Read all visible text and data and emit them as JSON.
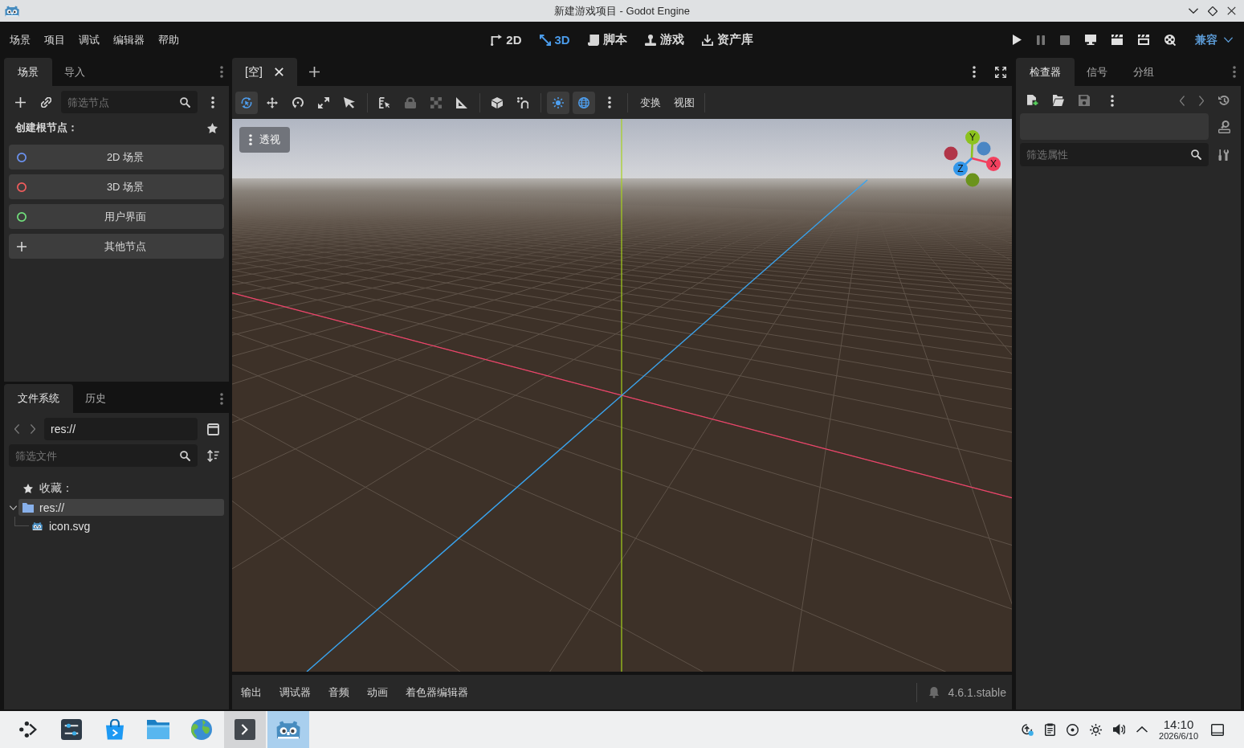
{
  "window": {
    "title": "新建游戏项目 - Godot Engine"
  },
  "menu_bar": {
    "menus": [
      "场景",
      "项目",
      "调试",
      "编辑器",
      "帮助"
    ],
    "main_screens": [
      {
        "label": "2D",
        "selected": false
      },
      {
        "label": "3D",
        "selected": true
      },
      {
        "label": "脚本",
        "selected": false
      },
      {
        "label": "游戏",
        "selected": false
      },
      {
        "label": "资产库",
        "selected": false
      }
    ],
    "run_buttons": [
      {
        "disabled": false
      },
      {
        "disabled": true
      },
      {
        "disabled": true
      },
      {
        "disabled": false
      },
      {
        "disabled": false
      },
      {
        "disabled": false
      },
      {
        "disabled": false
      }
    ],
    "renderer": "兼容"
  },
  "scene_dock": {
    "tabs": [
      {
        "label": "场景",
        "selected": true
      },
      {
        "label": "导入",
        "selected": false
      }
    ],
    "filter": {
      "placeholder": "筛选节点"
    },
    "heading": "创建根节点：",
    "root_options": [
      {
        "label": "2D 场景",
        "kind": "circle",
        "color": "#6c93f2"
      },
      {
        "label": "3D 场景",
        "kind": "circle",
        "color": "#f25d5d"
      },
      {
        "label": "用户界面",
        "kind": "circle",
        "color": "#71e07c"
      },
      {
        "label": "其他节点",
        "kind": "plus"
      }
    ]
  },
  "filesystem_dock": {
    "tabs": [
      {
        "label": "文件系统",
        "selected": true
      },
      {
        "label": "历史",
        "selected": false
      }
    ],
    "nav": [
      {
        "disabled": true
      },
      {
        "disabled": true
      }
    ],
    "path": "res://",
    "filter": {
      "placeholder": "筛选文件"
    },
    "favorites": "收藏：",
    "tree": [
      {
        "label": "res://",
        "kind": "folder",
        "selected": true,
        "expanded": true,
        "children": [
          {
            "label": "icon.svg",
            "kind": "file",
            "selected": false
          }
        ]
      }
    ]
  },
  "scene_tabs": [
    {
      "label": "[空]",
      "selected": true
    }
  ],
  "viewport_toolbar": {
    "tool_groups": [
      [
        {
          "selected": true,
          "disabled": false
        },
        {
          "selected": false,
          "disabled": false
        },
        {
          "selected": false,
          "disabled": false
        },
        {
          "selected": false,
          "disabled": false
        },
        {
          "selected": false,
          "disabled": false
        }
      ],
      [
        {
          "selected": false,
          "disabled": false
        },
        {
          "selected": false,
          "disabled": true
        },
        {
          "selected": false,
          "disabled": true
        },
        {
          "selected": false,
          "disabled": false
        }
      ],
      [
        {
          "selected": false,
          "disabled": false
        },
        {
          "selected": false,
          "disabled": false
        }
      ],
      [
        {
          "selected": true,
          "disabled": false
        },
        {
          "selected": true,
          "disabled": false
        }
      ]
    ],
    "menus": [
      "变换",
      "视图"
    ]
  },
  "viewport": {
    "view_menu": "透视",
    "gizmo": [
      {
        "label": "Y",
        "color": "#8cc21e"
      },
      {
        "label": "X",
        "color": "#f2405e"
      },
      {
        "label": "Z",
        "color": "#3397ea"
      }
    ]
  },
  "bottom_panel": {
    "tabs": [
      {
        "label": "输出",
        "selected": false
      },
      {
        "label": "调试器",
        "selected": false
      },
      {
        "label": "音频",
        "selected": false
      },
      {
        "label": "动画",
        "selected": false
      },
      {
        "label": "着色器编辑器",
        "selected": false
      }
    ],
    "version": "4.6.1.stable"
  },
  "inspector_dock": {
    "tabs": [
      {
        "label": "检查器",
        "selected": true
      },
      {
        "label": "信号",
        "selected": false
      },
      {
        "label": "分组",
        "selected": false
      }
    ],
    "buttons": [
      {
        "disabled": false
      },
      {
        "disabled": false
      },
      {
        "disabled": true
      }
    ],
    "history_nav": [
      {
        "disabled": true
      },
      {
        "disabled": true
      }
    ],
    "filter": {
      "placeholder": "筛选属性"
    }
  },
  "taskbar": {
    "apps": [
      {
        "running": false,
        "selected": false
      },
      {
        "running": false,
        "selected": false
      },
      {
        "running": false,
        "selected": false
      },
      {
        "running": false,
        "selected": false
      },
      {
        "running": false,
        "selected": false
      },
      {
        "running": true,
        "selected": false
      },
      {
        "running": false,
        "selected": true
      }
    ],
    "clock": {
      "time": "14:10",
      "date": "2026/6/10"
    }
  }
}
